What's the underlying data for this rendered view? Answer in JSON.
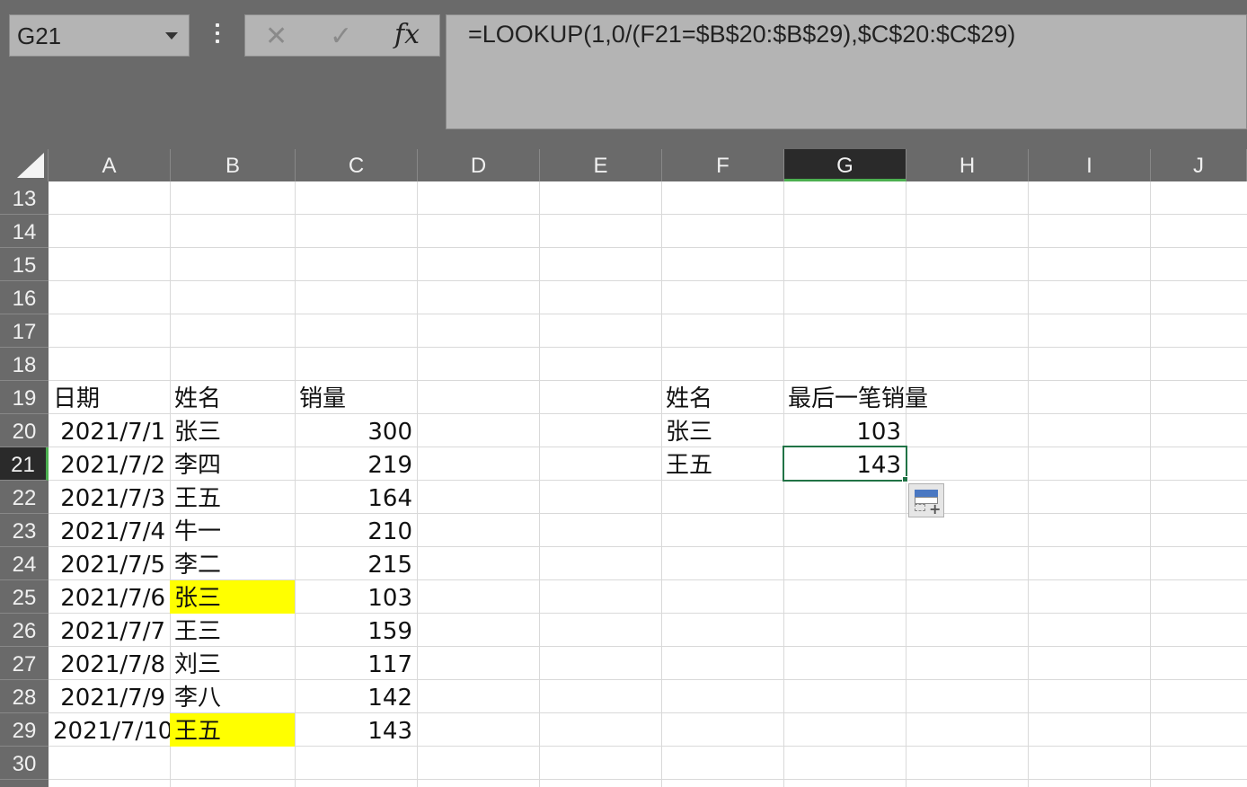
{
  "name_box": {
    "value": "G21"
  },
  "formula_bar": {
    "cancel_glyph": "✕",
    "enter_glyph": "✓",
    "fx_label": "fx",
    "formula": "=LOOKUP(1,0/(F21=$B$20:$B$29),$C$20:$C$29)"
  },
  "columns": [
    "A",
    "B",
    "C",
    "D",
    "E",
    "F",
    "G",
    "H",
    "I",
    "J"
  ],
  "active_column": "G",
  "rows": [
    "13",
    "14",
    "15",
    "16",
    "17",
    "18",
    "19",
    "20",
    "21",
    "22",
    "23",
    "24",
    "25",
    "26",
    "27",
    "28",
    "29",
    "30"
  ],
  "active_row": "21",
  "table1": {
    "headers": {
      "date": "日期",
      "name": "姓名",
      "sales": "销量"
    },
    "records": [
      {
        "date": "2021/7/1",
        "name": "张三",
        "sales": "300"
      },
      {
        "date": "2021/7/2",
        "name": "李四",
        "sales": "219"
      },
      {
        "date": "2021/7/3",
        "name": "王五",
        "sales": "164"
      },
      {
        "date": "2021/7/4",
        "name": "牛一",
        "sales": "210"
      },
      {
        "date": "2021/7/5",
        "name": "李二",
        "sales": "215"
      },
      {
        "date": "2021/7/6",
        "name": "张三",
        "sales": "103"
      },
      {
        "date": "2021/7/7",
        "name": "王三",
        "sales": "159"
      },
      {
        "date": "2021/7/8",
        "name": "刘三",
        "sales": "117"
      },
      {
        "date": "2021/7/9",
        "name": "李八",
        "sales": "142"
      },
      {
        "date": "2021/7/10",
        "name": "王五",
        "sales": "143"
      }
    ],
    "highlight_color": "#ffff00"
  },
  "table2": {
    "headers": {
      "name": "姓名",
      "last_sales": "最后一笔销量"
    },
    "records": [
      {
        "name": "张三",
        "last_sales": "103"
      },
      {
        "name": "王五",
        "last_sales": "143"
      }
    ]
  },
  "colors": {
    "selection": "#217346",
    "header_bg": "#6a6a6a",
    "active_header": "#2a2a2a"
  }
}
